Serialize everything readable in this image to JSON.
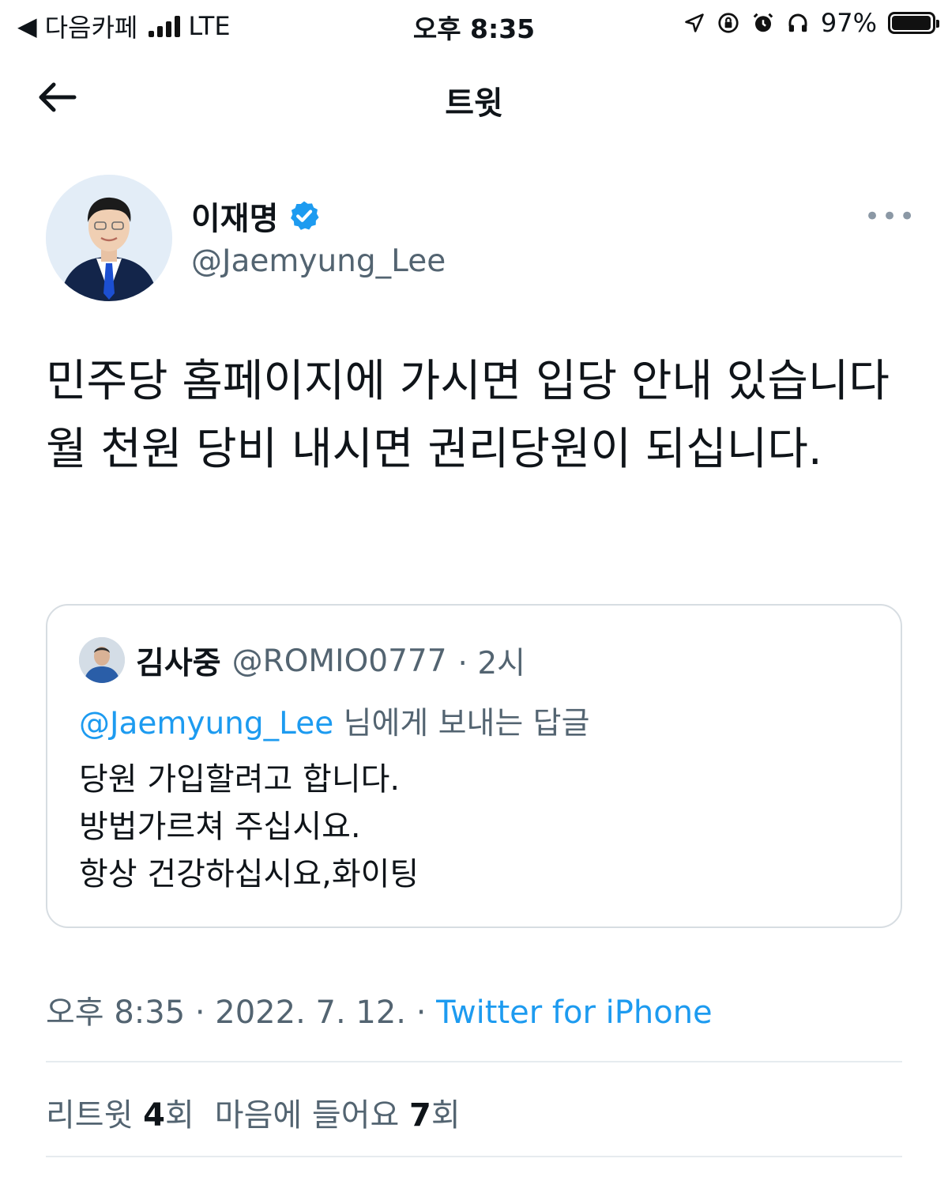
{
  "status_bar": {
    "back_app": "다음카페",
    "network": "LTE",
    "time": "오후 8:35",
    "battery": "97%",
    "battery_level": 0.97
  },
  "header": {
    "title": "트윗"
  },
  "author": {
    "name": "이재명",
    "handle": "@Jaemyung_Lee",
    "verified": true
  },
  "tweet": {
    "lines": [
      "민주당 홈페이지에 가시면 입당 안내 있습니다",
      "월 천원 당비 내시면 권리당원이 되십니다."
    ]
  },
  "quoted_tweet": {
    "name": "김사중",
    "handle": "@ROMIO0777",
    "time": "· 2시",
    "reply_mention": "@Jaemyung_Lee",
    "reply_suffix": "님에게 보내는 답글",
    "lines": [
      "당원 가입할려고 합니다.",
      "방법가르쳐 주십시요.",
      "항상 건강하십시요,화이팅"
    ]
  },
  "meta": {
    "timestamp": "오후 8:35 · 2022. 7. 12. ·",
    "source": "Twitter for iPhone"
  },
  "stats": {
    "retweets_label": "리트윗",
    "retweets_count": "4",
    "retweets_unit": "회",
    "likes_label": "마음에 들어요",
    "likes_count": "7",
    "likes_unit": "회"
  },
  "colors": {
    "link": "#1d9bf0",
    "secondary_text": "#536471",
    "border": "#d7dde2"
  }
}
